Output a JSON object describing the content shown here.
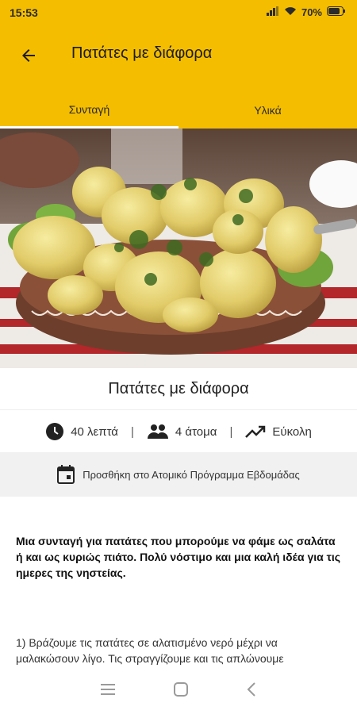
{
  "status_bar": {
    "time": "15:53",
    "battery": "70%"
  },
  "app_bar": {
    "title": "Πατάτες με διάφορα"
  },
  "tabs": [
    {
      "label": "Συνταγή"
    },
    {
      "label": "Υλικά"
    }
  ],
  "recipe": {
    "title": "Πατάτες με διάφορα",
    "time": "40 λεπτά",
    "servings": "4 άτομα",
    "difficulty": "Εύκολη",
    "separator": "|",
    "add_to_program": "Προσθήκη στο Ατομικό Πρόγραμμα Εβδομάδας",
    "description": "Μια συνταγή για πατάτες που μπορούμε να φάμε ως σαλάτα ή και ως κυριώς πιάτο. Πολύ νόστιμο και μια καλή ιδέα για τις ημερες της νηστείας.",
    "step_1": "1) Βράζουμε τις πατάτες σε αλατισμένο νερό μέχρι να μαλακώσουν λίγο. Τις στραγγίζουμε και τις απλώνουμε"
  },
  "colors": {
    "accent": "#f4bd00"
  }
}
